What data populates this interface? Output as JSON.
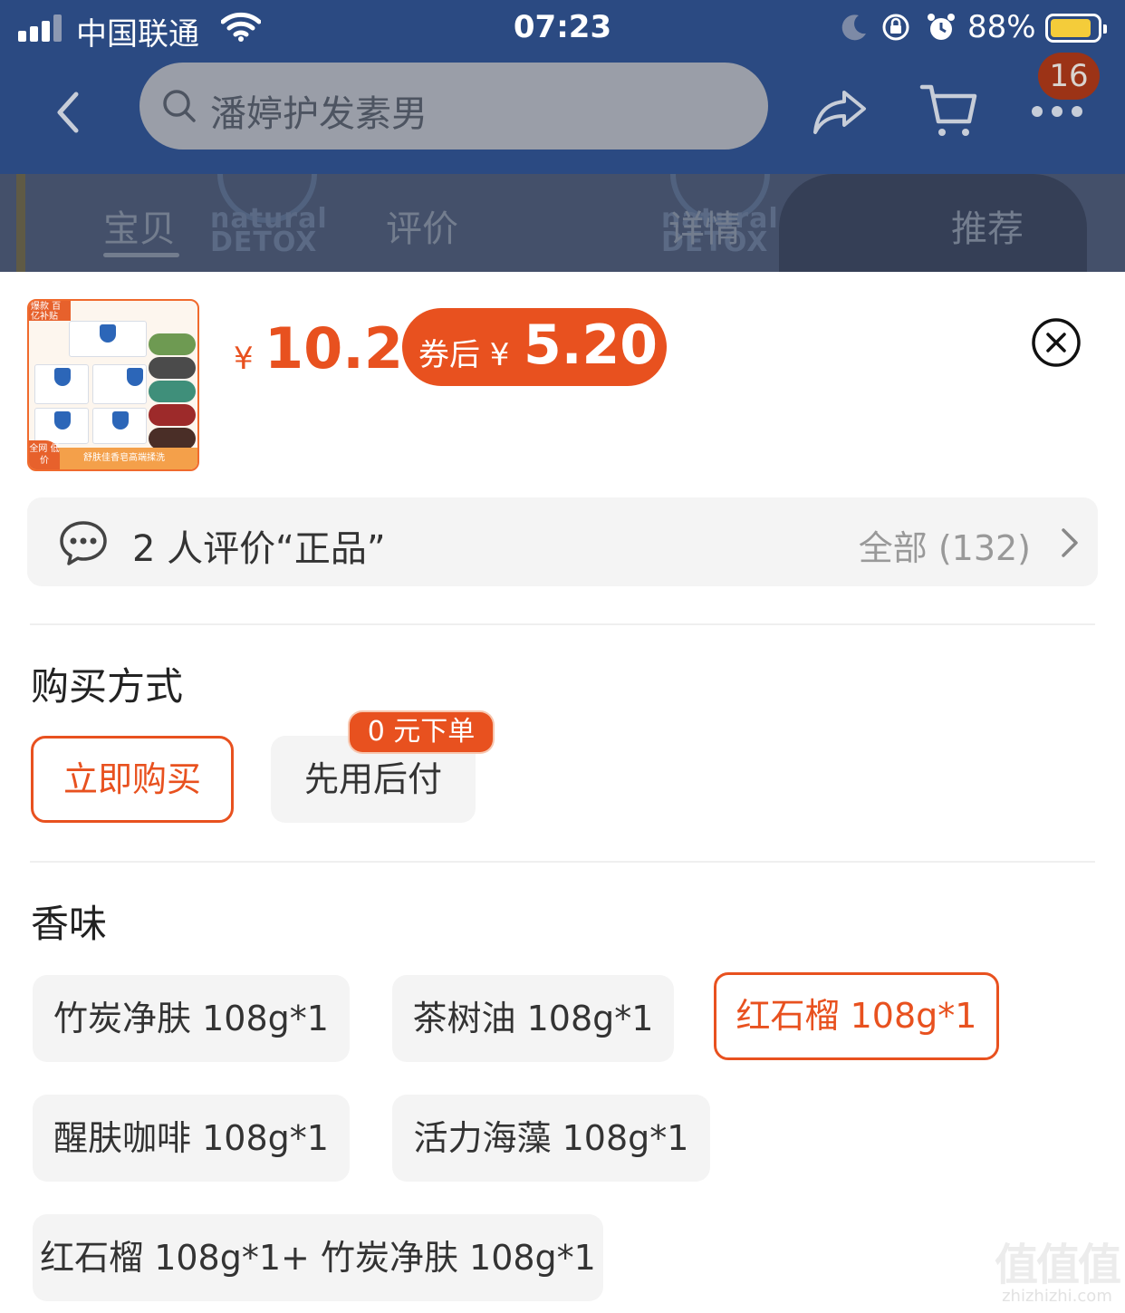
{
  "status_bar": {
    "carrier": "中国联通",
    "time": "07:23",
    "battery_percent": "88%",
    "battery_level": 0.88,
    "icons": [
      "signal-icon",
      "wifi-icon",
      "moon-icon",
      "orientation-lock-icon",
      "alarm-icon",
      "battery-icon"
    ]
  },
  "nav": {
    "search_placeholder": "潘婷护发素男",
    "cart_badge": "16",
    "icons": [
      "back-icon",
      "search-icon",
      "share-icon",
      "cart-icon",
      "more-icon"
    ]
  },
  "tabs": [
    "宝贝",
    "评价",
    "详情",
    "推荐"
  ],
  "banner_text": [
    "natural",
    "DETOX",
    "natural",
    "DETOX"
  ],
  "product": {
    "thumb_tag": "爆款 百亿补贴",
    "thumb_footer": "舒肤佳香皂高端揉洗",
    "thumb_low": "全网 低价",
    "price_symbol": "¥",
    "price": "10.2",
    "coupon_label": "券后 ¥",
    "coupon_price": "5.20"
  },
  "review": {
    "text": "2 人评价“正品”",
    "all": "全部 (132)"
  },
  "purchase": {
    "title": "购买方式",
    "options": [
      "立即购买",
      "先用后付"
    ],
    "selected": "立即购买",
    "badge": "0 元下单"
  },
  "scent": {
    "title": "香味",
    "options": [
      "竹炭净肤 108g*1",
      "茶树油 108g*1",
      "红石榴 108g*1",
      "醒肤咖啡 108g*1",
      "活力海藻 108g*1",
      "红石榴 108g*1+ 竹炭净肤 108g*1"
    ],
    "selected": "红石榴 108g*1"
  },
  "watermark": {
    "big": "值值值",
    "small": "zhizhizhi.com"
  },
  "colors": {
    "accent": "#e8511f",
    "nav_bg": "#2b4a82",
    "chip_bg": "#f4f4f4"
  }
}
